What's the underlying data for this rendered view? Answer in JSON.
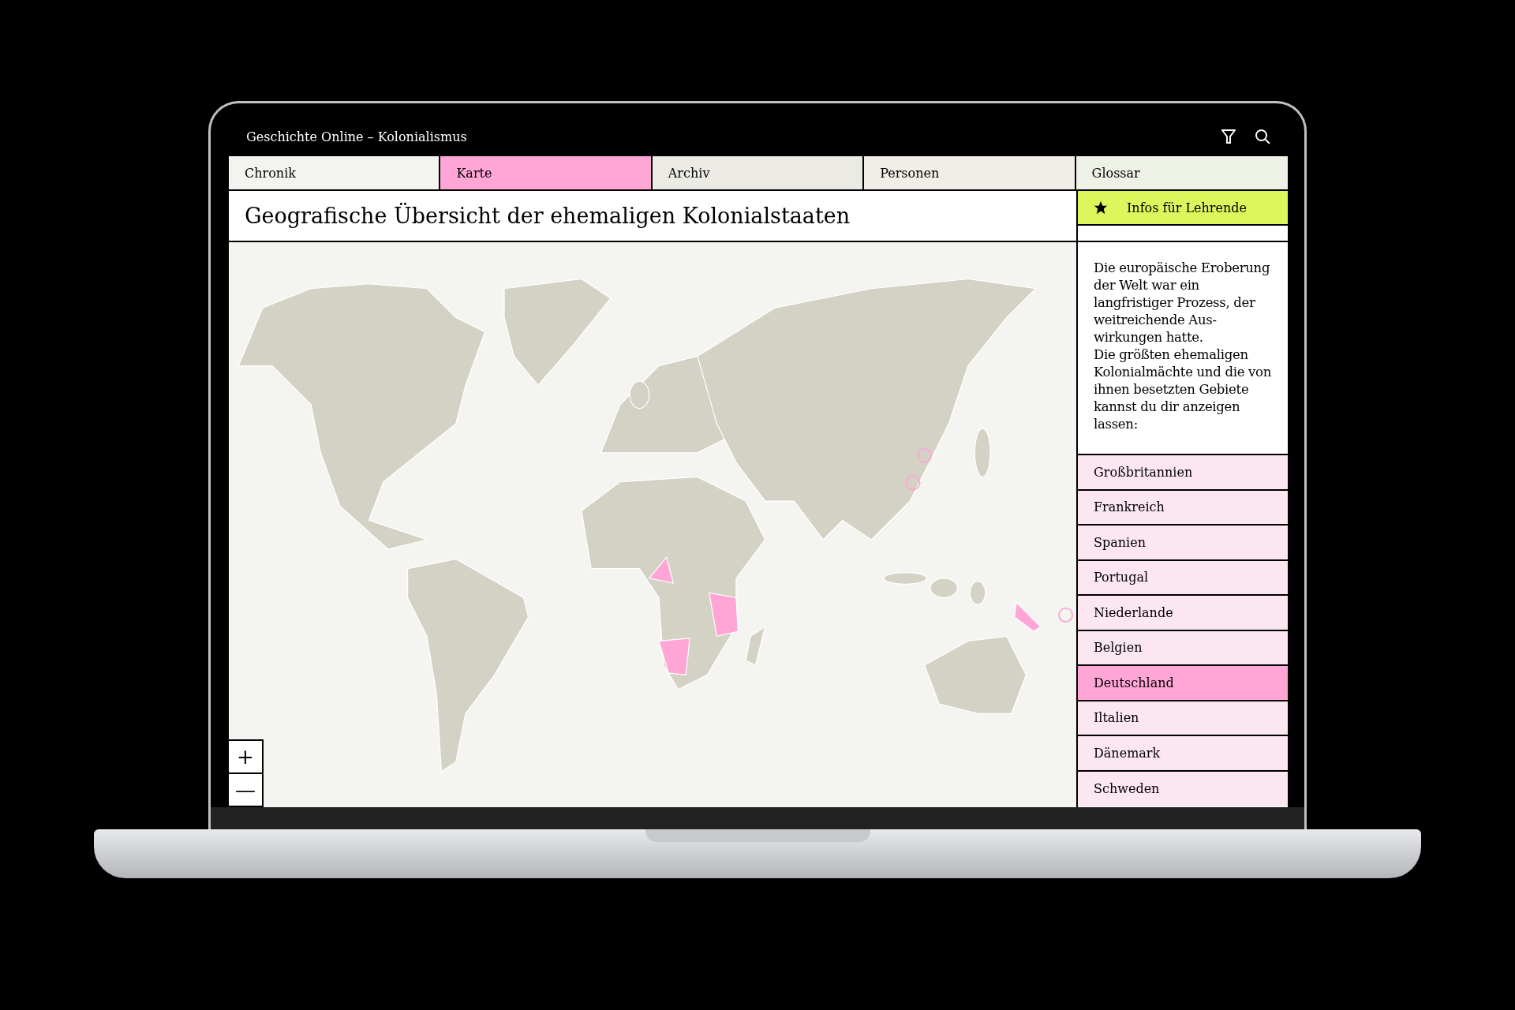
{
  "app_title": "Geschichte Online – Kolonialismus",
  "tabs": [
    {
      "label": "Chronik",
      "selected": false
    },
    {
      "label": "Karte",
      "selected": true
    },
    {
      "label": "Archiv",
      "selected": false
    },
    {
      "label": "Personen",
      "selected": false
    },
    {
      "label": "Glossar",
      "selected": false
    }
  ],
  "page_title": "Geografische Übersicht der ehemaligen Kolonialstaaten",
  "teacher_button": "Infos für Lehrende",
  "intro": [
    "Die europäische Eroberung der Welt war ein langfristiger Prozess, der weitreichende Aus-wirkungen hatte.",
    "Die größten ehemaligen Kolonialmächte und die von ihnen besetzten Gebiete kannst du dir anzeigen lassen:"
  ],
  "countries": [
    {
      "label": "Großbritannien",
      "selected": false
    },
    {
      "label": "Frankreich",
      "selected": false
    },
    {
      "label": "Spanien",
      "selected": false
    },
    {
      "label": "Portugal",
      "selected": false
    },
    {
      "label": "Niederlande",
      "selected": false
    },
    {
      "label": "Belgien",
      "selected": false
    },
    {
      "label": "Deutschland",
      "selected": true
    },
    {
      "label": "Iltalien",
      "selected": false
    },
    {
      "label": "Dänemark",
      "selected": false
    },
    {
      "label": "Schweden",
      "selected": false
    }
  ],
  "zoom": [
    "+",
    "—"
  ]
}
